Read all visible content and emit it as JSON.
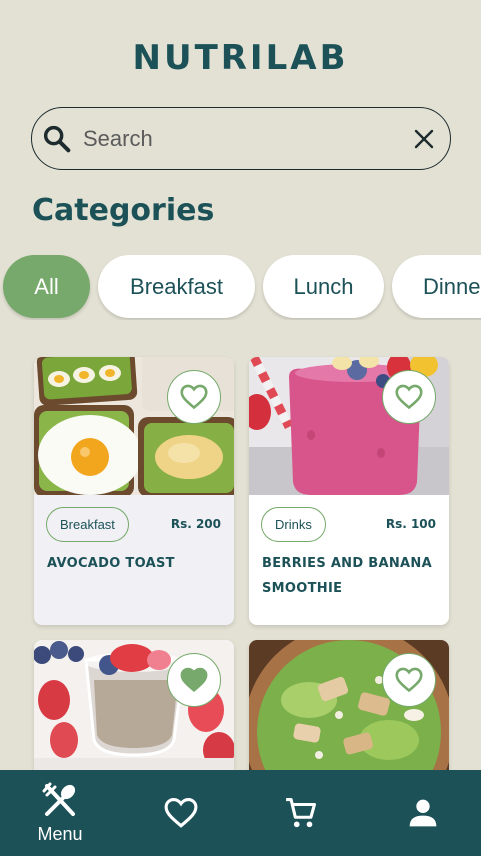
{
  "app": {
    "logo": "NUTRILAB"
  },
  "search": {
    "placeholder": "Search",
    "value": ""
  },
  "section": {
    "title": "Categories"
  },
  "categories": [
    {
      "label": "All",
      "active": true
    },
    {
      "label": "Breakfast",
      "active": false
    },
    {
      "label": "Lunch",
      "active": false
    },
    {
      "label": "Dinner",
      "active": false
    }
  ],
  "products": [
    {
      "tag": "Breakfast",
      "price": "Rs. 200",
      "name": "AVOCADO TOAST",
      "favorite": false
    },
    {
      "tag": "Drinks",
      "price": "Rs. 100",
      "name": "BERRIES AND BANANA SMOOTHIE",
      "favorite": false
    },
    {
      "tag": "",
      "price": "",
      "name": "",
      "favorite": true
    },
    {
      "tag": "",
      "price": "",
      "name": "",
      "favorite": false
    }
  ],
  "nav": {
    "menu_label": "Menu",
    "items": [
      "menu",
      "favorites",
      "cart",
      "profile"
    ],
    "active": "menu"
  },
  "colors": {
    "brand": "#1b5157",
    "accent": "#76a96b",
    "background": "#e2e1d3",
    "card": "#ffffff"
  }
}
